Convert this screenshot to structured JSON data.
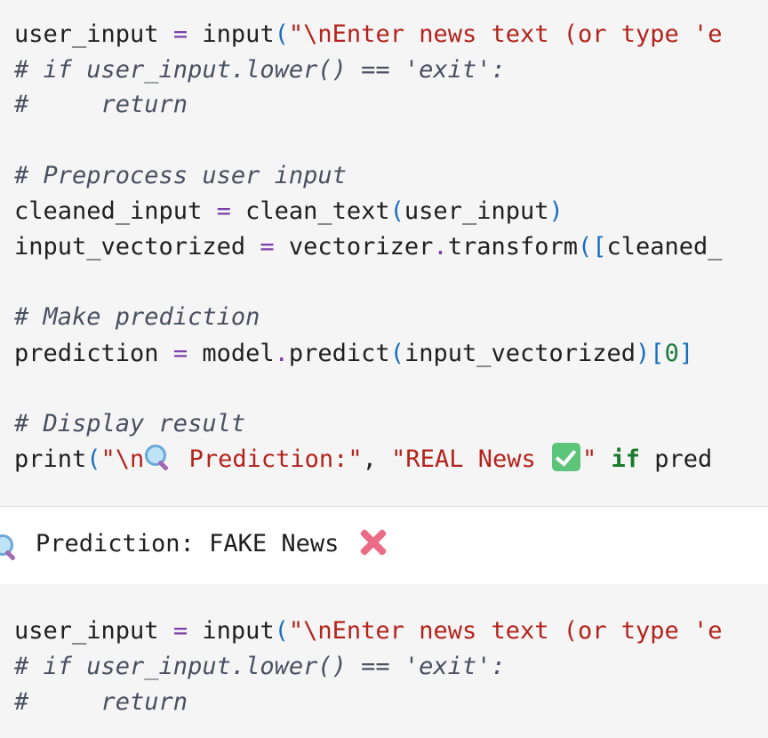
{
  "cell1": {
    "lines": [
      "user_input = input(\"\\nEnter news text (or type 'e",
      "# if user_input.lower() == 'exit':",
      "#     return",
      "",
      "# Preprocess user input",
      "cleaned_input = clean_text(user_input)",
      "input_vectorized = vectorizer.transform([cleaned_",
      "",
      "# Make prediction",
      "prediction = model.predict(input_vectorized)[0]",
      "",
      "# Display result",
      "print(\"\\n Prediction:\", \"REAL News \" if pred"
    ]
  },
  "output": {
    "text": "Prediction: FAKE News",
    "icons": [
      "magnifier-icon",
      "cross-mark-icon"
    ]
  },
  "cell2": {
    "lines": [
      "user_input = input(\"\\nEnter news text (or type 'e",
      "# if user_input.lower() == 'exit':",
      "#     return"
    ]
  },
  "colors": {
    "background": "#f5f5f5",
    "comment": "#4a5060",
    "operator": "#7a3fa8",
    "string": "#b3231c",
    "keyword": "#1a7a2a",
    "number": "#1a7a3c",
    "bracket": "#1a6fc0"
  }
}
